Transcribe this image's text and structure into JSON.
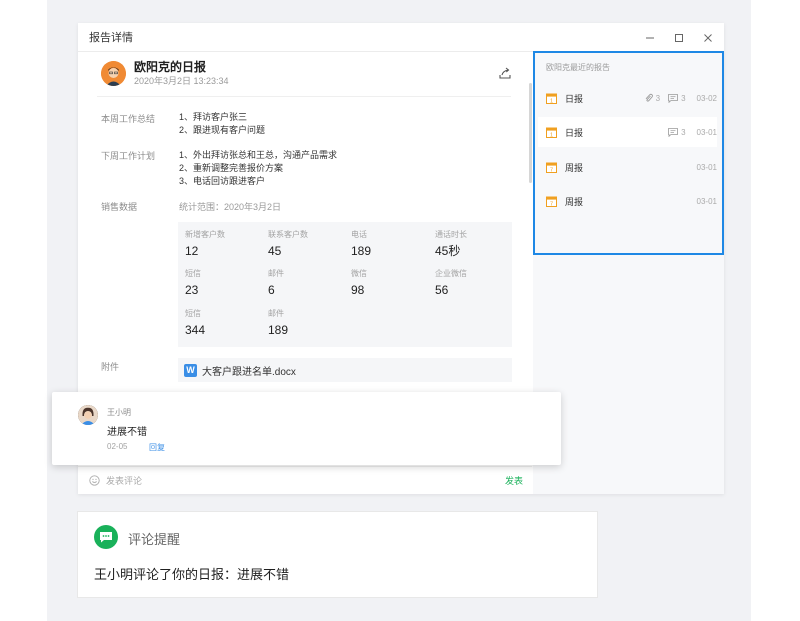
{
  "window": {
    "title": "报告详情"
  },
  "report": {
    "title": "欧阳克的日报",
    "time": "2020年3月2日 13:23:34",
    "this_week_label": "本周工作总结",
    "this_week_lines": [
      "1、拜访客户张三",
      "2、跟进现有客户问题"
    ],
    "next_week_label": "下周工作计划",
    "next_week_lines": [
      "1、外出拜访张总和王总，沟通产品需求",
      "2、重新调整完善报价方案",
      "3、电话回访跟进客户"
    ],
    "sales_label": "销售数据",
    "range": "统计范围：2020年3月2日",
    "stats": [
      {
        "key": "新增客户数",
        "value": "12"
      },
      {
        "key": "联系客户数",
        "value": "45"
      },
      {
        "key": "电话",
        "value": "189"
      },
      {
        "key": "通话时长",
        "value": "45秒"
      },
      {
        "key": "短信",
        "value": "23"
      },
      {
        "key": "邮件",
        "value": "6"
      },
      {
        "key": "微信",
        "value": "98"
      },
      {
        "key": "企业微信",
        "value": "56"
      },
      {
        "key": "短信",
        "value": "344"
      },
      {
        "key": "邮件",
        "value": "189"
      }
    ],
    "attachment_label": "附件",
    "attachment_file": "大客户跟进名单.docx"
  },
  "comment_bar": {
    "placeholder": "发表评论",
    "send": "发表"
  },
  "recent": {
    "title": "欧阳克最近的报告",
    "items": [
      {
        "name": "日报",
        "attachments": "3",
        "comments": "3",
        "date": "03-02"
      },
      {
        "name": "日报",
        "attachments": "",
        "comments": "3",
        "date": "03-01"
      },
      {
        "name": "周报",
        "attachments": "",
        "comments": "",
        "date": "03-01"
      },
      {
        "name": "周报",
        "attachments": "",
        "comments": "",
        "date": "03-01"
      }
    ]
  },
  "popup_comment": {
    "author": "王小明",
    "text": "进展不错",
    "date": "02-05",
    "reply": "回复"
  },
  "notification": {
    "title": "评论提醒",
    "body": "王小明评论了你的日报：进展不错"
  },
  "colors": {
    "accent_green": "#19b15a",
    "highlight_blue": "#1e88e5",
    "avatar_orange": "#f08a34"
  }
}
